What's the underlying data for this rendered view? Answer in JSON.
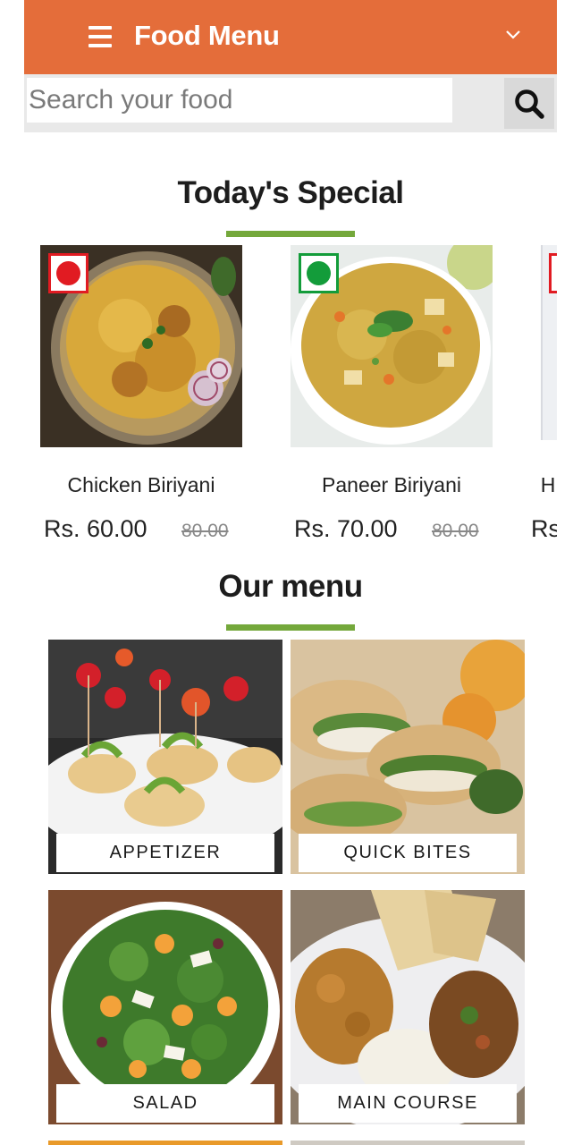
{
  "header": {
    "title": "Food Menu",
    "menu_icon": "hamburger-menu-icon",
    "dropdown_icon": "chevron-down-icon",
    "background_color": "#e46d3a"
  },
  "search": {
    "placeholder": "Search your food",
    "value": "",
    "icon": "search-icon"
  },
  "specials": {
    "title": "Today's Special",
    "accent_color": "#74a83b",
    "items": [
      {
        "name": "Chicken Biriyani",
        "price": "Rs. 60.00",
        "old_price": "80.00",
        "type": "non-veg",
        "marker_color": "#e11b22"
      },
      {
        "name": "Paneer Biriyani",
        "price": "Rs. 70.00",
        "old_price": "80.00",
        "type": "veg",
        "marker_color": "#139c3a"
      },
      {
        "name": "H",
        "price": "Rs",
        "type": "non-veg",
        "marker_color": "#e11b22"
      }
    ]
  },
  "menu": {
    "title": "Our menu",
    "categories": [
      {
        "label": "APPETIZER"
      },
      {
        "label": "QUICK BITES"
      },
      {
        "label": "SALAD"
      },
      {
        "label": "MAIN COURSE"
      }
    ]
  }
}
